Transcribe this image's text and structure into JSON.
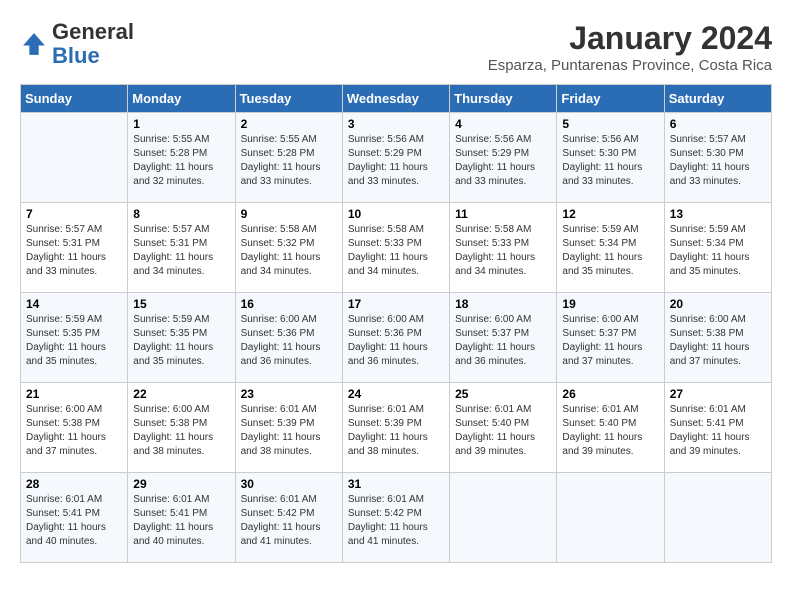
{
  "logo": {
    "text_general": "General",
    "text_blue": "Blue"
  },
  "title": "January 2024",
  "subtitle": "Esparza, Puntarenas Province, Costa Rica",
  "columns": [
    "Sunday",
    "Monday",
    "Tuesday",
    "Wednesday",
    "Thursday",
    "Friday",
    "Saturday"
  ],
  "weeks": [
    [
      {
        "day": "",
        "info": ""
      },
      {
        "day": "1",
        "info": "Sunrise: 5:55 AM\nSunset: 5:28 PM\nDaylight: 11 hours\nand 32 minutes."
      },
      {
        "day": "2",
        "info": "Sunrise: 5:55 AM\nSunset: 5:28 PM\nDaylight: 11 hours\nand 33 minutes."
      },
      {
        "day": "3",
        "info": "Sunrise: 5:56 AM\nSunset: 5:29 PM\nDaylight: 11 hours\nand 33 minutes."
      },
      {
        "day": "4",
        "info": "Sunrise: 5:56 AM\nSunset: 5:29 PM\nDaylight: 11 hours\nand 33 minutes."
      },
      {
        "day": "5",
        "info": "Sunrise: 5:56 AM\nSunset: 5:30 PM\nDaylight: 11 hours\nand 33 minutes."
      },
      {
        "day": "6",
        "info": "Sunrise: 5:57 AM\nSunset: 5:30 PM\nDaylight: 11 hours\nand 33 minutes."
      }
    ],
    [
      {
        "day": "7",
        "info": "Sunrise: 5:57 AM\nSunset: 5:31 PM\nDaylight: 11 hours\nand 33 minutes."
      },
      {
        "day": "8",
        "info": "Sunrise: 5:57 AM\nSunset: 5:31 PM\nDaylight: 11 hours\nand 34 minutes."
      },
      {
        "day": "9",
        "info": "Sunrise: 5:58 AM\nSunset: 5:32 PM\nDaylight: 11 hours\nand 34 minutes."
      },
      {
        "day": "10",
        "info": "Sunrise: 5:58 AM\nSunset: 5:33 PM\nDaylight: 11 hours\nand 34 minutes."
      },
      {
        "day": "11",
        "info": "Sunrise: 5:58 AM\nSunset: 5:33 PM\nDaylight: 11 hours\nand 34 minutes."
      },
      {
        "day": "12",
        "info": "Sunrise: 5:59 AM\nSunset: 5:34 PM\nDaylight: 11 hours\nand 35 minutes."
      },
      {
        "day": "13",
        "info": "Sunrise: 5:59 AM\nSunset: 5:34 PM\nDaylight: 11 hours\nand 35 minutes."
      }
    ],
    [
      {
        "day": "14",
        "info": "Sunrise: 5:59 AM\nSunset: 5:35 PM\nDaylight: 11 hours\nand 35 minutes."
      },
      {
        "day": "15",
        "info": "Sunrise: 5:59 AM\nSunset: 5:35 PM\nDaylight: 11 hours\nand 35 minutes."
      },
      {
        "day": "16",
        "info": "Sunrise: 6:00 AM\nSunset: 5:36 PM\nDaylight: 11 hours\nand 36 minutes."
      },
      {
        "day": "17",
        "info": "Sunrise: 6:00 AM\nSunset: 5:36 PM\nDaylight: 11 hours\nand 36 minutes."
      },
      {
        "day": "18",
        "info": "Sunrise: 6:00 AM\nSunset: 5:37 PM\nDaylight: 11 hours\nand 36 minutes."
      },
      {
        "day": "19",
        "info": "Sunrise: 6:00 AM\nSunset: 5:37 PM\nDaylight: 11 hours\nand 37 minutes."
      },
      {
        "day": "20",
        "info": "Sunrise: 6:00 AM\nSunset: 5:38 PM\nDaylight: 11 hours\nand 37 minutes."
      }
    ],
    [
      {
        "day": "21",
        "info": "Sunrise: 6:00 AM\nSunset: 5:38 PM\nDaylight: 11 hours\nand 37 minutes."
      },
      {
        "day": "22",
        "info": "Sunrise: 6:00 AM\nSunset: 5:38 PM\nDaylight: 11 hours\nand 38 minutes."
      },
      {
        "day": "23",
        "info": "Sunrise: 6:01 AM\nSunset: 5:39 PM\nDaylight: 11 hours\nand 38 minutes."
      },
      {
        "day": "24",
        "info": "Sunrise: 6:01 AM\nSunset: 5:39 PM\nDaylight: 11 hours\nand 38 minutes."
      },
      {
        "day": "25",
        "info": "Sunrise: 6:01 AM\nSunset: 5:40 PM\nDaylight: 11 hours\nand 39 minutes."
      },
      {
        "day": "26",
        "info": "Sunrise: 6:01 AM\nSunset: 5:40 PM\nDaylight: 11 hours\nand 39 minutes."
      },
      {
        "day": "27",
        "info": "Sunrise: 6:01 AM\nSunset: 5:41 PM\nDaylight: 11 hours\nand 39 minutes."
      }
    ],
    [
      {
        "day": "28",
        "info": "Sunrise: 6:01 AM\nSunset: 5:41 PM\nDaylight: 11 hours\nand 40 minutes."
      },
      {
        "day": "29",
        "info": "Sunrise: 6:01 AM\nSunset: 5:41 PM\nDaylight: 11 hours\nand 40 minutes."
      },
      {
        "day": "30",
        "info": "Sunrise: 6:01 AM\nSunset: 5:42 PM\nDaylight: 11 hours\nand 41 minutes."
      },
      {
        "day": "31",
        "info": "Sunrise: 6:01 AM\nSunset: 5:42 PM\nDaylight: 11 hours\nand 41 minutes."
      },
      {
        "day": "",
        "info": ""
      },
      {
        "day": "",
        "info": ""
      },
      {
        "day": "",
        "info": ""
      }
    ]
  ]
}
